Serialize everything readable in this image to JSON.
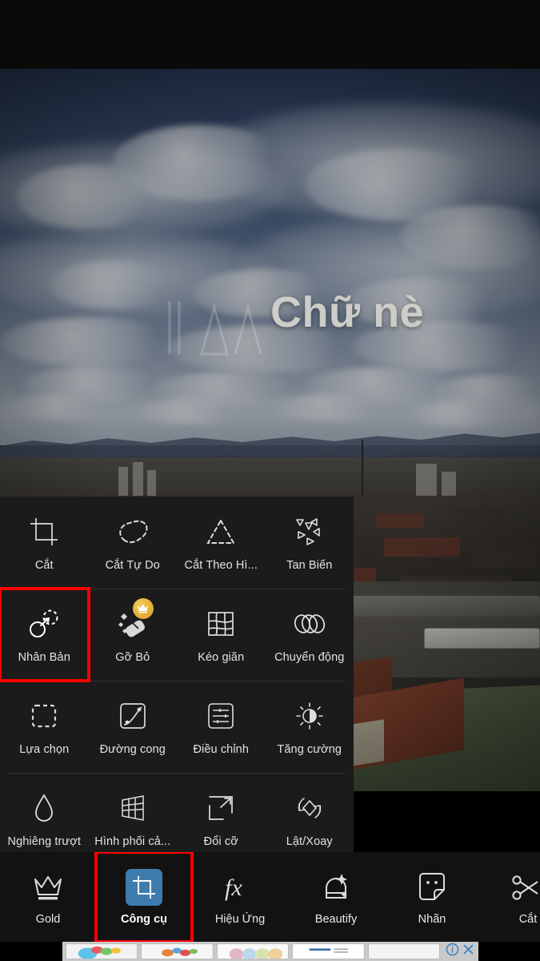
{
  "app": {
    "overlay_text": "Chữ nè",
    "accent_blue": "#3f7cae",
    "highlight_red": "#ff0000",
    "panel_bg": "#1b1b1b",
    "nav_bg": "#121212",
    "premium_gold": "#e0ad33"
  },
  "tools_panel": {
    "rows": [
      {
        "items": [
          {
            "label": "Cắt",
            "icon": "crop-icon",
            "premium": false,
            "highlighted": false
          },
          {
            "label": "Cắt Tự Do",
            "icon": "freehand-cut-icon",
            "premium": false,
            "highlighted": false
          },
          {
            "label": "Cắt Theo Hì...",
            "icon": "shape-cut-icon",
            "premium": false,
            "highlighted": false
          },
          {
            "label": "Tan Biến",
            "icon": "dispersion-icon",
            "premium": false,
            "highlighted": false
          }
        ]
      },
      {
        "items": [
          {
            "label": "Nhân Bản",
            "icon": "clone-stamp-icon",
            "premium": false,
            "highlighted": true
          },
          {
            "label": "Gỡ Bỏ",
            "icon": "eraser-remove-icon",
            "premium": true,
            "highlighted": false
          },
          {
            "label": "Kéo giãn",
            "icon": "stretch-grid-icon",
            "premium": false,
            "highlighted": false
          },
          {
            "label": "Chuyển động",
            "icon": "motion-icon",
            "premium": false,
            "highlighted": false
          }
        ]
      },
      {
        "items": [
          {
            "label": "Lựa chọn",
            "icon": "selection-icon",
            "premium": false,
            "highlighted": false
          },
          {
            "label": "Đường cong",
            "icon": "curves-icon",
            "premium": false,
            "highlighted": false
          },
          {
            "label": "Điều chỉnh",
            "icon": "adjust-sliders-icon",
            "premium": false,
            "highlighted": false
          },
          {
            "label": "Tăng cường",
            "icon": "enhance-brightness-icon",
            "premium": false,
            "highlighted": false
          }
        ]
      },
      {
        "items": [
          {
            "label": "Nghiêng trượt",
            "icon": "tilt-shift-drop-icon",
            "premium": false,
            "highlighted": false
          },
          {
            "label": "Hình phối cả...",
            "icon": "perspective-grid-icon",
            "premium": false,
            "highlighted": false
          },
          {
            "label": "Đổi cỡ",
            "icon": "resize-icon",
            "premium": false,
            "highlighted": false
          },
          {
            "label": "Lật/Xoay",
            "icon": "flip-rotate-icon",
            "premium": false,
            "highlighted": false
          }
        ]
      }
    ]
  },
  "bottom_nav": {
    "items": [
      {
        "label": "Gold",
        "icon": "crown-icon",
        "active": false,
        "highlighted": false
      },
      {
        "label": "Công cụ",
        "icon": "tools-crop-icon",
        "active": true,
        "highlighted": true
      },
      {
        "label": "Hiệu Ứng",
        "icon": "fx-icon",
        "active": false,
        "highlighted": false
      },
      {
        "label": "Beautify",
        "icon": "beautify-face-icon",
        "active": false,
        "highlighted": false
      },
      {
        "label": "Nhãn",
        "icon": "sticker-icon",
        "active": false,
        "highlighted": false
      },
      {
        "label": "Cắt",
        "icon": "cut-scissors-icon",
        "active": false,
        "highlighted": false
      }
    ]
  },
  "ad_banner": {
    "info_icon": "info-icon",
    "close_icon": "close-icon",
    "cells": [
      {
        "name": "ad-thumb-1"
      },
      {
        "name": "ad-thumb-2"
      },
      {
        "name": "ad-thumb-3"
      },
      {
        "name": "ad-thumb-4"
      },
      {
        "name": "ad-thumb-5"
      }
    ]
  }
}
